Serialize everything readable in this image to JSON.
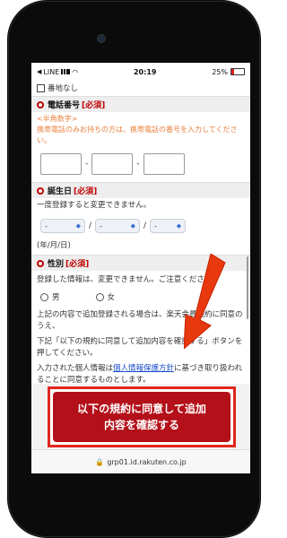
{
  "status": {
    "carrier": "LINE",
    "time": "20:19",
    "battery": "25%",
    "battery_level": 0.25
  },
  "form": {
    "no_address_label": "番地なし",
    "phone": {
      "title": "電話番号",
      "required": "[必須]",
      "note_line1": "<半角数字>",
      "note_line2": "携帯電話のみお持ちの方は、携帯電話の番号を入力してください。",
      "separator": "-"
    },
    "birthday": {
      "title": "誕生日",
      "required": "[必須]",
      "note": "一度登録すると変更できません。",
      "select_placeholder": "-",
      "separator": "/",
      "format_label": "(年/月/日)"
    },
    "gender": {
      "title": "性別",
      "required": "[必須]",
      "note": "登録した情報は、変更できません。ご注意ください。",
      "options": [
        "男",
        "女"
      ]
    },
    "terms": {
      "para1": "上記の内容で追加登録される場合は、楽天会員規約に同意のうえ、",
      "para2": "下記「以下の規約に同意して追加内容を確認する」ボタンを押してください。",
      "para3_pre": "入力された個人情報は",
      "para3_link": "個人情報保護方針",
      "para3_post": "に基づき取り扱われることに同意するものとします。"
    },
    "confirm_button": "以下の規約に同意して追加内容を確認する"
  },
  "browser": {
    "url": "grp01.id.rakuten.co.jp"
  },
  "colors": {
    "accent": "#bf0000",
    "highlight_border": "#e3261e"
  }
}
